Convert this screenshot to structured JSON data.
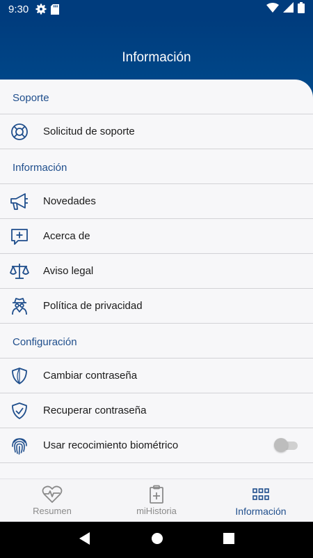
{
  "status_bar": {
    "time": "9:30"
  },
  "header": {
    "title": "Información"
  },
  "sections": [
    {
      "title": "Soporte",
      "items": [
        {
          "label": "Solicitud de soporte",
          "icon": "lifebuoy-icon"
        }
      ]
    },
    {
      "title": "Información",
      "items": [
        {
          "label": "Novedades",
          "icon": "megaphone-icon"
        },
        {
          "label": "Acerca de",
          "icon": "chat-plus-icon"
        },
        {
          "label": "Aviso legal",
          "icon": "scales-icon"
        },
        {
          "label": "Política de privacidad",
          "icon": "spy-icon"
        }
      ]
    },
    {
      "title": "Configuración",
      "items": [
        {
          "label": "Cambiar contraseña",
          "icon": "shield-icon"
        },
        {
          "label": "Recuperar contraseña",
          "icon": "shield-check-icon"
        },
        {
          "label": "Usar recocimiento biométrico",
          "icon": "fingerprint-icon",
          "toggle": false
        }
      ]
    }
  ],
  "bottom_nav": [
    {
      "label": "Resumen",
      "icon": "heart-pulse-icon",
      "active": false
    },
    {
      "label": "miHistoria",
      "icon": "clipboard-plus-icon",
      "active": false
    },
    {
      "label": "Información",
      "icon": "grid-icon",
      "active": true
    }
  ],
  "colors": {
    "primary": "#003c7d",
    "accent": "#1f4e8c",
    "background": "#f7f7f9"
  }
}
